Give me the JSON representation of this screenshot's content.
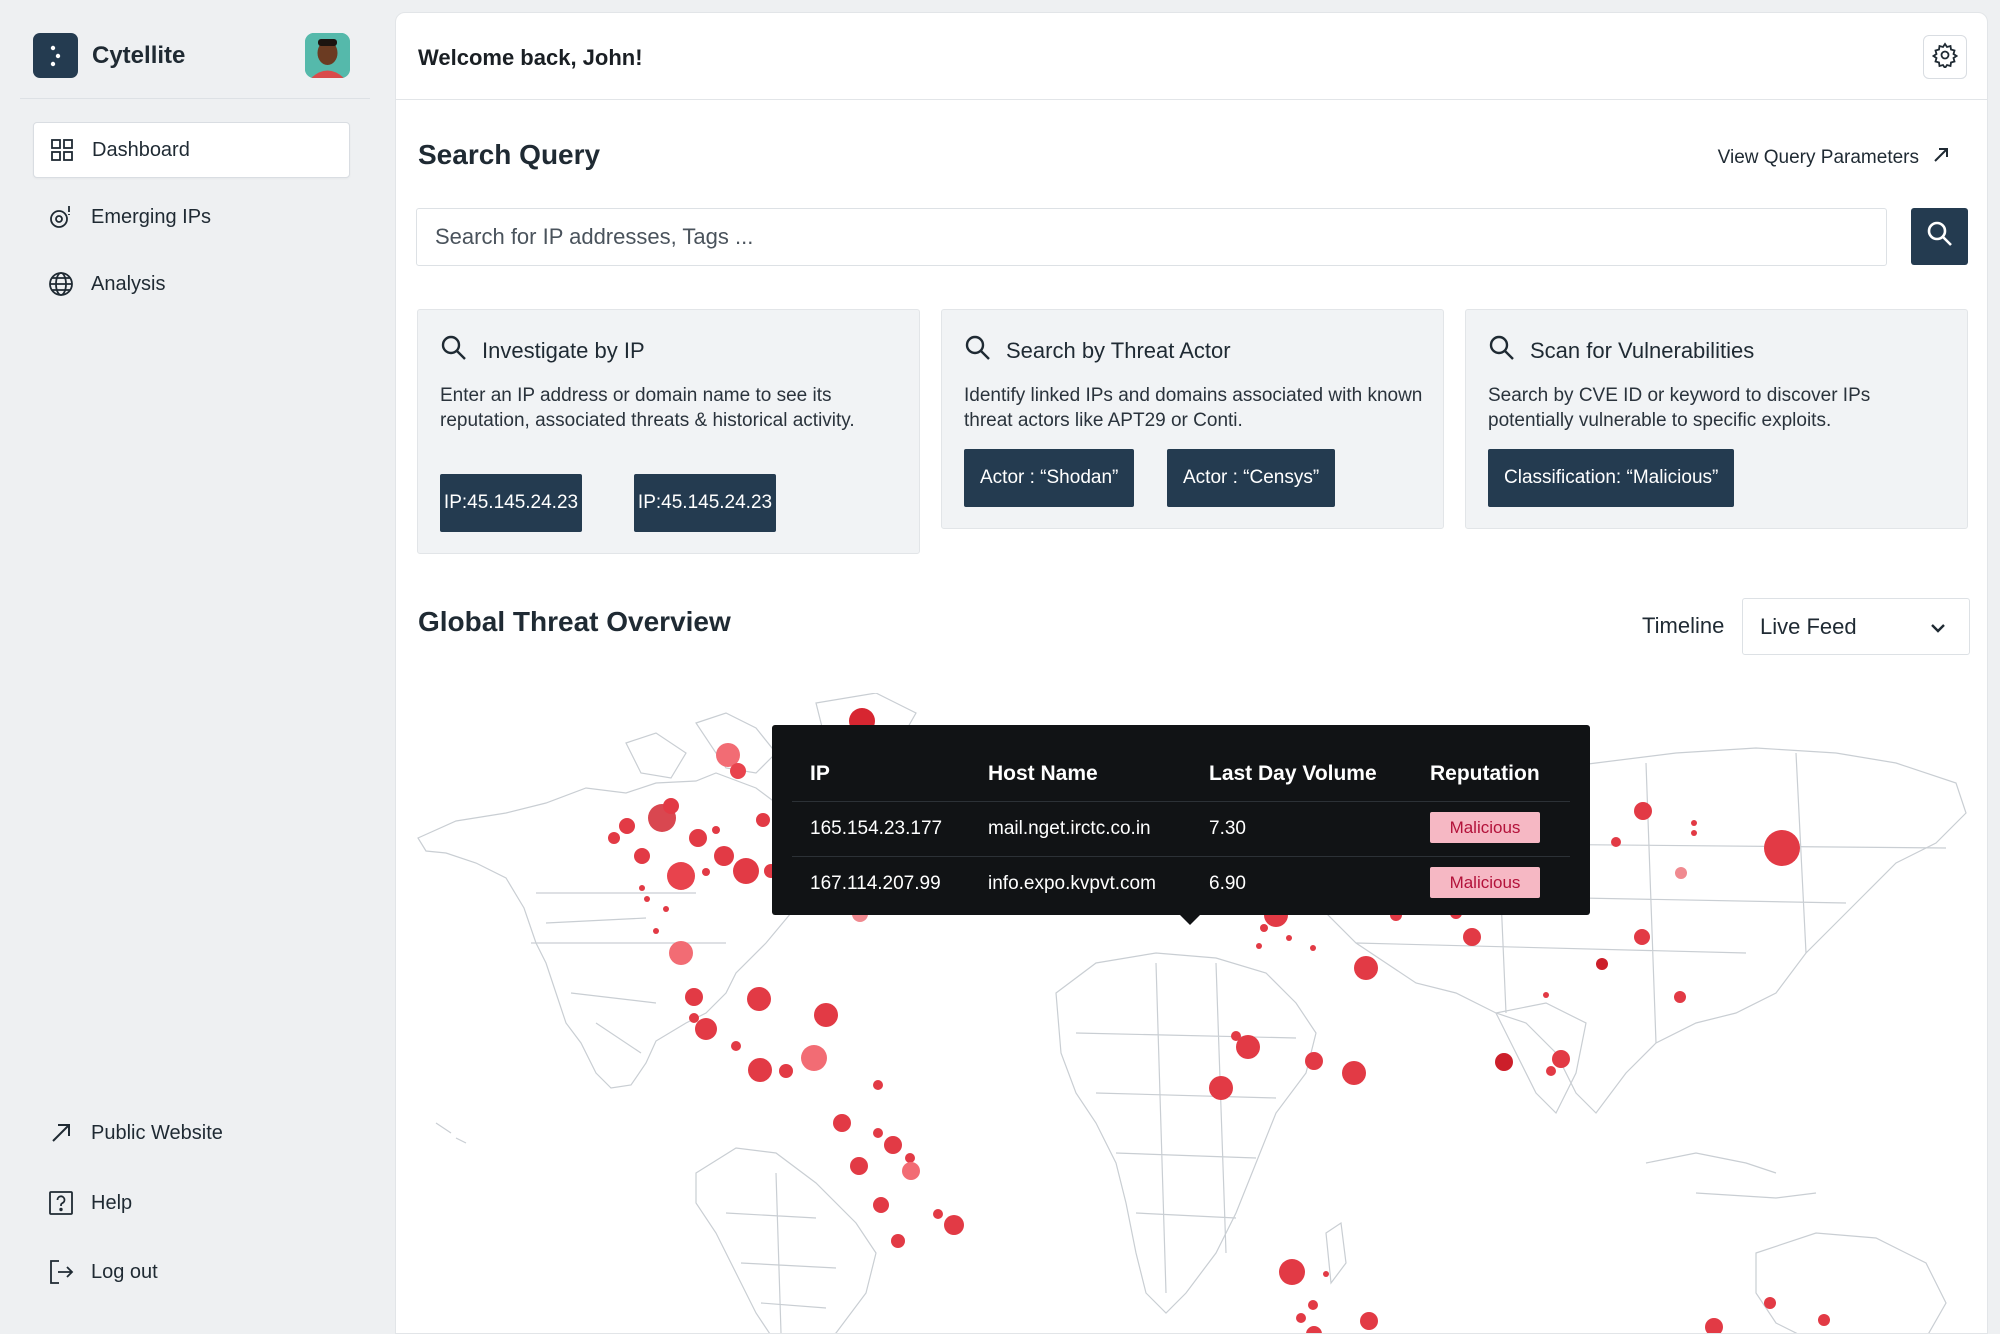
{
  "app": {
    "name": "Cytellite"
  },
  "sidebar": {
    "nav": [
      {
        "label": "Dashboard",
        "icon": "grid-icon",
        "active": true
      },
      {
        "label": "Emerging IPs",
        "icon": "emerging-icon",
        "active": false
      },
      {
        "label": "Analysis",
        "icon": "globe-icon",
        "active": false
      }
    ],
    "footer": [
      {
        "label": "Public Website",
        "icon": "external-arrow-icon"
      },
      {
        "label": "Help",
        "icon": "help-icon"
      },
      {
        "label": "Log out",
        "icon": "logout-icon"
      }
    ]
  },
  "header": {
    "welcome": "Welcome back, John!"
  },
  "search": {
    "title": "Search Query",
    "view_params": "View Query Parameters",
    "placeholder": "Search for IP addresses, Tags ..."
  },
  "cards": [
    {
      "title": "Investigate by IP",
      "description": "Enter an IP address or domain name to see its reputation, associated threats & historical activity.",
      "chips": [
        "IP:45.145.24.23",
        "IP:45.145.24.23"
      ]
    },
    {
      "title": "Search by Threat Actor",
      "description": "Identify linked IPs and domains associated with known threat actors like APT29 or Conti.",
      "chips": [
        "Actor : “Shodan”",
        "Actor : “Censys”"
      ]
    },
    {
      "title": "Scan for Vulnerabilities",
      "description": "Search by CVE ID or keyword to discover IPs potentially vulnerable to specific exploits.",
      "chips": [
        "Classification: “Malicious”"
      ]
    }
  ],
  "overview": {
    "title": "Global Threat Overview",
    "timeline_label": "Timeline",
    "timeline_value": "Live Feed"
  },
  "tooltip": {
    "headers": [
      "IP",
      "Host Name",
      "Last Day Volume",
      "Reputation"
    ],
    "rows": [
      {
        "ip": "165.154.23.177",
        "host": "mail.nget.irctc.co.in",
        "volume": "7.30",
        "reputation": "Malicious"
      },
      {
        "ip": "167.114.207.99",
        "host": "info.expo.kvpvt.com",
        "volume": "6.90",
        "reputation": "Malicious"
      }
    ]
  },
  "colors": {
    "accent": "#243b50",
    "threat": "#e23a45",
    "badge_bg": "#f6b8c4",
    "badge_text": "#b3123a"
  }
}
